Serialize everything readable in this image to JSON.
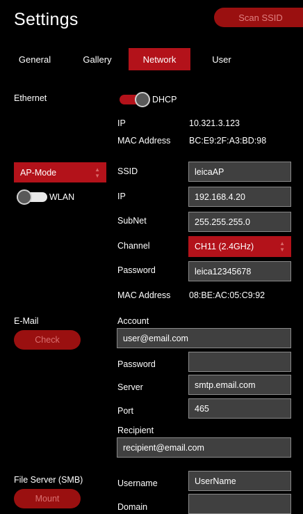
{
  "header": {
    "title": "Settings",
    "scan_label": "Scan SSID"
  },
  "tabs": [
    {
      "label": "General",
      "active": false
    },
    {
      "label": "Gallery",
      "active": false
    },
    {
      "label": "Network",
      "active": true
    },
    {
      "label": "User",
      "active": false
    }
  ],
  "ethernet": {
    "section_label": "Ethernet",
    "dhcp_label": "DHCP",
    "dhcp_on": true,
    "ip_label": "IP",
    "ip_value": "10.321.3.123",
    "mac_label": "MAC Address",
    "mac_value": "BC:E9:2F:A3:BD:98"
  },
  "wifi": {
    "mode_value": "AP-Mode",
    "wlan_label": "WLAN",
    "wlan_on": false,
    "ssid_label": "SSID",
    "ssid_value": "leicaAP",
    "ip_label": "IP",
    "ip_value": "192.168.4.20",
    "subnet_label": "SubNet",
    "subnet_value": "255.255.255.0",
    "channel_label": "Channel",
    "channel_value": "CH11 (2.4GHz)",
    "password_label": "Password",
    "password_value": "leica12345678",
    "mac_label": "MAC Address",
    "mac_value": "08:BE:AC:05:C9:92"
  },
  "email": {
    "section_label": "E-Mail",
    "check_label": "Check",
    "account_label": "Account",
    "account_value": "user@email.com",
    "password_label": "Password",
    "password_value": "",
    "server_label": "Server",
    "server_value": "smtp.email.com",
    "port_label": "Port",
    "port_value": "465",
    "recipient_label": "Recipient",
    "recipient_value": "recipient@email.com"
  },
  "smb": {
    "section_label": "File Server (SMB)",
    "mount_label": "Mount",
    "username_label": "Username",
    "username_value": "UserName",
    "domain_label": "Domain",
    "domain_value": ""
  },
  "colors": {
    "accent": "#b3121a",
    "button_dark": "#9a1010",
    "field_bg": "#404040",
    "field_border": "#8a8a8a"
  }
}
